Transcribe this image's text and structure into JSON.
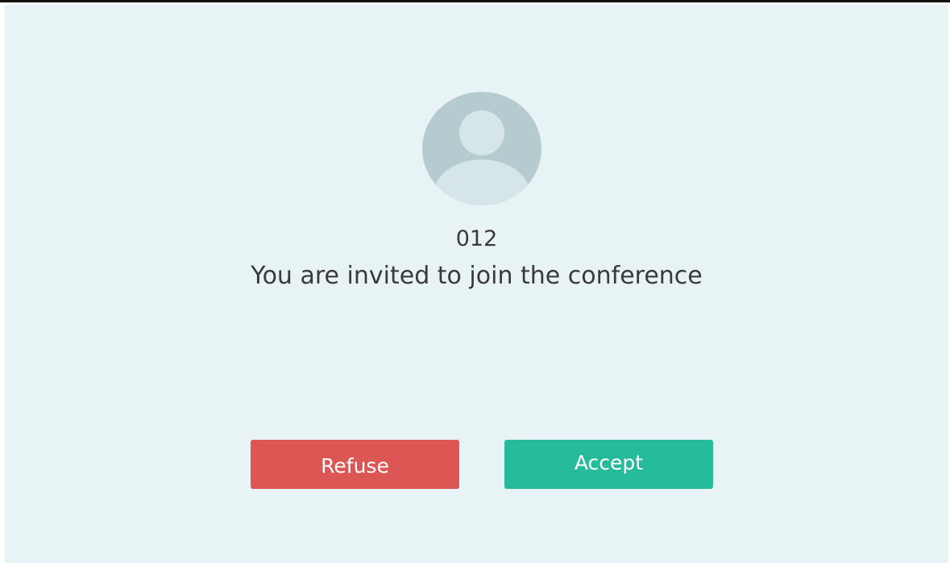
{
  "call": {
    "caller_id": "012",
    "message": "You are invited to join the conference"
  },
  "actions": {
    "refuse_label": "Refuse",
    "accept_label": "Accept"
  },
  "avatar": {
    "icon": "user-avatar-icon"
  },
  "colors": {
    "background": "#e8f3f5",
    "avatar_bg": "#b6cbcf",
    "avatar_figure": "#d6e5e8",
    "text": "#3a3a3a",
    "refuse": "#dc5654",
    "accept": "#26bb9a",
    "button_text": "#ffffff"
  }
}
